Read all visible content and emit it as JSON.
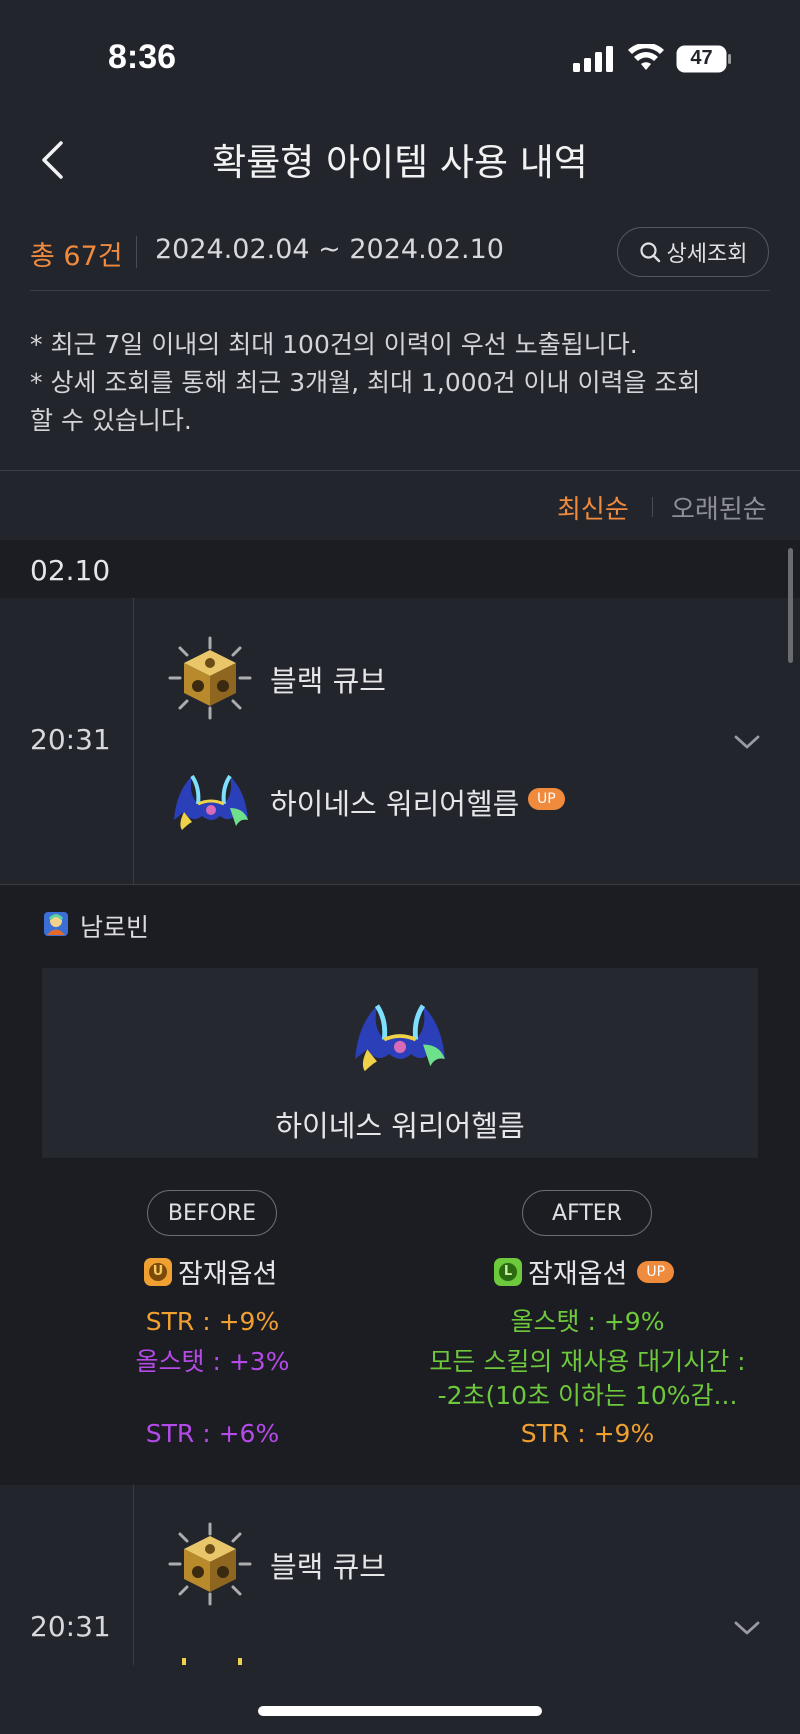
{
  "status": {
    "time": "8:36",
    "battery": "47"
  },
  "header": {
    "title": "확률형 아이템 사용 내역"
  },
  "summary": {
    "total": "총 67건",
    "date_range": "2024.02.04 ~ 2024.02.10",
    "detail_button": "상세조회"
  },
  "notice": {
    "line1": "* 최근 7일 이내의 최대 100건의 이력이 우선 노출됩니다.",
    "line2": "* 상세 조회를 통해 최근 3개월, 최대 1,000건 이내 이력을 조회",
    "line3": "할 수 있습니다."
  },
  "sort": {
    "newest": "최신순",
    "oldest": "오래된순"
  },
  "date_group": "02.10",
  "entries": [
    {
      "time": "20:31",
      "cube": "블랙 큐브",
      "item": "하이네스 워리어헬름",
      "badge": "UP"
    },
    {
      "time": "20:31",
      "cube": "블랙 큐브"
    }
  ],
  "detail": {
    "character": "남로빈",
    "item_name": "하이네스 워리어헬름",
    "before": {
      "label": "BEFORE",
      "grade_letter": "U",
      "potential_title": "잠재옵션",
      "options": [
        "STR : +9%",
        "올스탯 : +3%",
        "STR : +6%"
      ]
    },
    "after": {
      "label": "AFTER",
      "grade_letter": "L",
      "potential_title": "잠재옵션",
      "badge": "UP",
      "options": [
        "올스탯 : +9%",
        "모든 스킬의 재사용 대기시간 :",
        "-2초(10초 이하는 10%감...",
        "STR : +9%"
      ]
    }
  },
  "colors": {
    "accent": "#f08a3c",
    "unique": "#f0a030",
    "epic": "#b44ae8",
    "legendary": "#6ec83c"
  }
}
